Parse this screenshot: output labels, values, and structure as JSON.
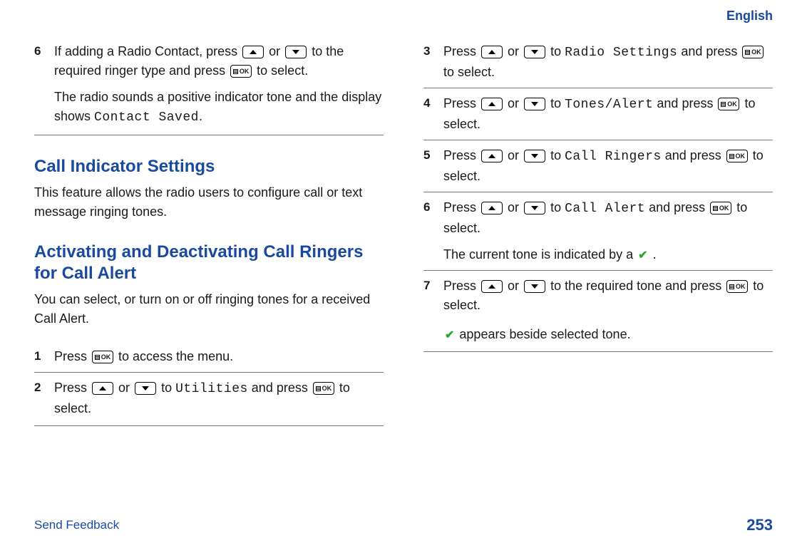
{
  "language_label": "English",
  "section1": {
    "step6": {
      "num": "6",
      "line1a": "If adding a Radio Contact, press ",
      "line1b": " or ",
      "line1c": " to the required ringer type and press ",
      "line1d": " to select.",
      "line2a": "The radio sounds a positive indicator tone and the display shows ",
      "code": "Contact Saved",
      "line2b": "."
    }
  },
  "heading_settings": "Call Indicator Settings",
  "intro_settings": "This feature allows the radio users to configure call or text message ringing tones.",
  "heading_ringers": "Activating and Deactivating Call Ringers for Call Alert",
  "intro_ringers": "You can select, or turn on or off ringing tones for a received Call Alert.",
  "steps": {
    "s1": {
      "num": "1",
      "a": "Press ",
      "b": " to access the menu."
    },
    "s2": {
      "num": "2",
      "a": "Press ",
      "b": " or ",
      "c": " to ",
      "code": "Utilities",
      "d": " and press ",
      "e": " to select."
    },
    "s3": {
      "num": "3",
      "a": "Press ",
      "b": " or ",
      "c": " to ",
      "code": "Radio Settings",
      "d": " and press ",
      "e": " to select."
    },
    "s4": {
      "num": "4",
      "a": "Press ",
      "b": " or ",
      "c": " to ",
      "code": "Tones/Alert",
      "d": " and press ",
      "e": " to select."
    },
    "s5": {
      "num": "5",
      "a": "Press ",
      "b": " or ",
      "c": " to ",
      "code": "Call Ringers",
      "d": " and press ",
      "e": " to select."
    },
    "s6": {
      "num": "6",
      "a": "Press ",
      "b": " or ",
      "c": " to ",
      "code": "Call Alert",
      "d": " and press ",
      "e": " to select.",
      "f": "The current tone is indicated by a ",
      "g": " ."
    },
    "s7": {
      "num": "7",
      "a": "Press ",
      "b": " or ",
      "c": " to the required tone and press ",
      "d": " to select.",
      "f": " appears beside selected tone."
    }
  },
  "footer": {
    "feedback": "Send Feedback",
    "page": "253"
  }
}
